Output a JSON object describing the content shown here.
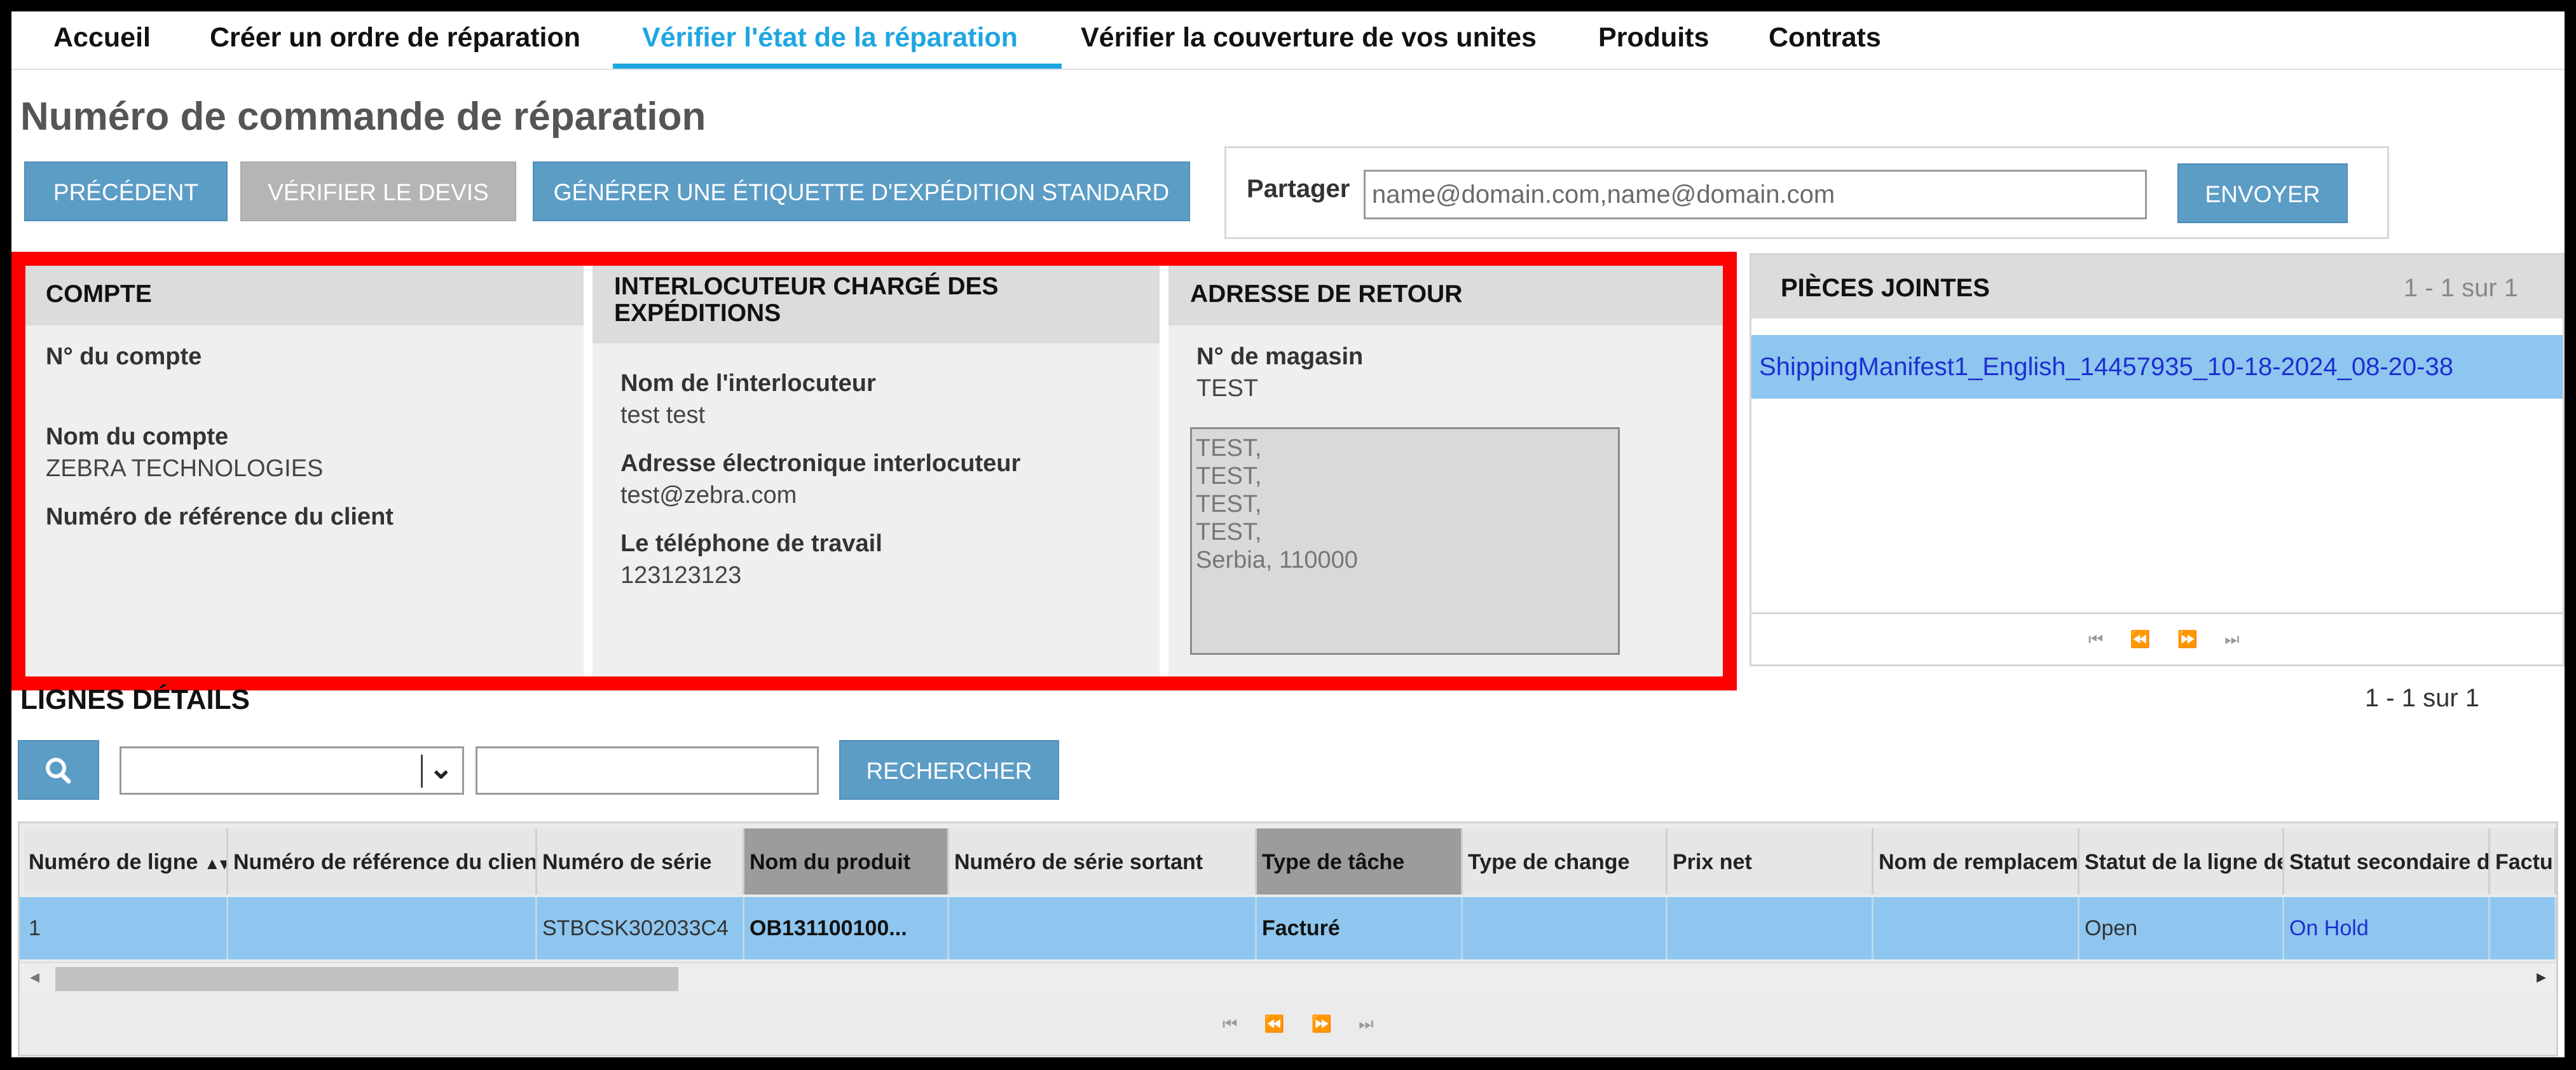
{
  "nav": {
    "items": [
      {
        "label": "Accueil",
        "active": false
      },
      {
        "label": "Créer un ordre de réparation",
        "active": false
      },
      {
        "label": "Vérifier l'état de la réparation",
        "active": true
      },
      {
        "label": "Vérifier la couverture de vos unites",
        "active": false
      },
      {
        "label": "Produits",
        "active": false
      },
      {
        "label": "Contrats",
        "active": false
      }
    ]
  },
  "page": {
    "title": "Numéro de commande de réparation"
  },
  "toolbar": {
    "previous": "PRÉCÉDENT",
    "check_quote": "VÉRIFIER LE DEVIS",
    "generate_label": "GÉNÉRER UNE ÉTIQUETTE D'EXPÉDITION STANDARD"
  },
  "share": {
    "label": "Partager",
    "placeholder": "name@domain.com,name@domain.com",
    "send": "ENVOYER"
  },
  "account": {
    "title": "COMPTE",
    "number_label": "N° du compte",
    "number_value": "",
    "name_label": "Nom du compte",
    "name_value": "ZEBRA TECHNOLOGIES",
    "ref_label": "Numéro de référence du client",
    "ref_value": ""
  },
  "contact": {
    "title": "INTERLOCUTEUR CHARGÉ DES EXPÉDITIONS",
    "name_label": "Nom de l'interlocuteur",
    "name_value": "test test",
    "email_label": "Adresse électronique interlocuteur",
    "email_value": "test@zebra.com",
    "phone_label": "Le téléphone de travail",
    "phone_value": "123123123"
  },
  "return_address": {
    "title": "ADRESSE DE RETOUR",
    "store_label": "N° de magasin",
    "store_value": "TEST",
    "address": "TEST,\nTEST,\nTEST,\nTEST,\nSerbia, 110000"
  },
  "attachments": {
    "title": "PIÈCES JOINTES",
    "count": "1 - 1 sur 1",
    "items": [
      "ShippingManifest1_English_14457935_10-18-2024_08-20-38"
    ]
  },
  "lines": {
    "title": "LIGNES DÉTAILS",
    "count": "1 - 1 sur 1",
    "search_button": "RECHERCHER",
    "columns": [
      "Numéro de ligne",
      "Numéro de référence du client",
      "Numéro de série",
      "Nom du produit",
      "Numéro de série sortant",
      "Type de tâche",
      "Type de change",
      "Prix net",
      "Nom de remplacement",
      "Statut de la ligne de",
      "Statut secondaire de",
      "Factu"
    ],
    "rows": [
      {
        "line": "1",
        "client_ref": "",
        "serial": "STBCSK302033C4",
        "product": "OB131100100...",
        "out_serial": "",
        "task_type": "Facturé",
        "change_type": "",
        "net_price": "",
        "replacement": "",
        "line_status": "Open",
        "secondary_status": "On Hold",
        "invoice": ""
      }
    ]
  },
  "colors": {
    "accent": "#1fa6e0",
    "button": "#5c9dc6",
    "row_selected": "#8ec6ef",
    "highlight_border": "#ff0000"
  }
}
